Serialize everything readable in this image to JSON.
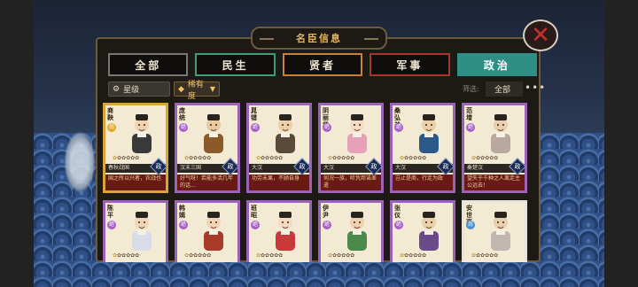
{
  "window": {
    "title": "名臣信息",
    "close_icon": "close-icon"
  },
  "tabs": [
    {
      "label": "全部",
      "border": "#7a7670",
      "bg": "#0f0e0c",
      "active": false
    },
    {
      "label": "民生",
      "border": "#3f9b7a",
      "bg": "#0f0e0c",
      "active": false
    },
    {
      "label": "贤者",
      "border": "#c9813a",
      "bg": "#0f0e0c",
      "active": false
    },
    {
      "label": "军事",
      "border": "#a8352e",
      "bg": "#0f0e0c",
      "active": false
    },
    {
      "label": "政治",
      "border": "#2f8f86",
      "bg": "#2f8f86",
      "active": true
    }
  ],
  "filters": {
    "star_label": "星级",
    "rarity_label": "稀有度",
    "filter_label": "筛选:",
    "filter_value": "全部",
    "more_icon": "more-icon"
  },
  "cards": [
    {
      "name": "商鞅",
      "grade": "尚",
      "rarity": "gold",
      "origin": "春秋战国",
      "type": "政",
      "desc": "国之所以兴者，农战也",
      "robe": "#3a3a3a",
      "skin": "#f0d2b0"
    },
    {
      "name": "庞统",
      "grade": "绝",
      "rarity": "purple",
      "origin": "汉末三国",
      "type": "政",
      "desc": "好气呀！若能多活几年的话…",
      "robe": "#8a5a2a",
      "skin": "#e8c9a0"
    },
    {
      "name": "晁错",
      "grade": "绝",
      "rarity": "purple",
      "origin": "大汉",
      "type": "政",
      "desc": "功劳未果，不顾自身",
      "robe": "#5a4a3a",
      "skin": "#ecd0aa"
    },
    {
      "name": "阴丽华",
      "grade": "绝",
      "rarity": "purple",
      "origin": "大汉",
      "type": "政",
      "desc": "何况一族，听凭邦诺差遣",
      "robe": "#e6a0b8",
      "skin": "#f3dac2"
    },
    {
      "name": "桑弘羊",
      "grade": "绝",
      "rarity": "purple",
      "origin": "大汉",
      "type": "政",
      "desc": "岂止是商，行走为政",
      "robe": "#2b5a8a",
      "skin": "#ebcfa8"
    },
    {
      "name": "范增",
      "grade": "绝",
      "rarity": "purple",
      "origin": "秦楚汉",
      "type": "政",
      "desc": "望失于千种之人离走主公远去！",
      "robe": "#b8a8a0",
      "skin": "#e8cfae"
    },
    {
      "name": "陈平",
      "grade": "绝",
      "rarity": "purple",
      "origin": "",
      "type": "",
      "desc": "",
      "robe": "#d8dce8",
      "skin": "#f0d6b6"
    },
    {
      "name": "韩嫣",
      "grade": "绝",
      "rarity": "purple",
      "origin": "",
      "type": "",
      "desc": "",
      "robe": "#a83a2a",
      "skin": "#f2d4b4"
    },
    {
      "name": "班昭",
      "grade": "绝",
      "rarity": "purple",
      "origin": "",
      "type": "",
      "desc": "",
      "robe": "#c83a3a",
      "skin": "#f3dac0"
    },
    {
      "name": "伊尹",
      "grade": "绝",
      "rarity": "purple",
      "origin": "",
      "type": "",
      "desc": "",
      "robe": "#4a8a4a",
      "skin": "#ecd2ae"
    },
    {
      "name": "张仪",
      "grade": "绝",
      "rarity": "purple",
      "origin": "",
      "type": "",
      "desc": "",
      "robe": "#6a4a8a",
      "skin": "#ecd0aa"
    },
    {
      "name": "安世高",
      "grade": "尚",
      "rarity": "white",
      "origin": "",
      "type": "",
      "desc": "",
      "robe": "#c0b8b0",
      "skin": "#e8cfae"
    }
  ]
}
